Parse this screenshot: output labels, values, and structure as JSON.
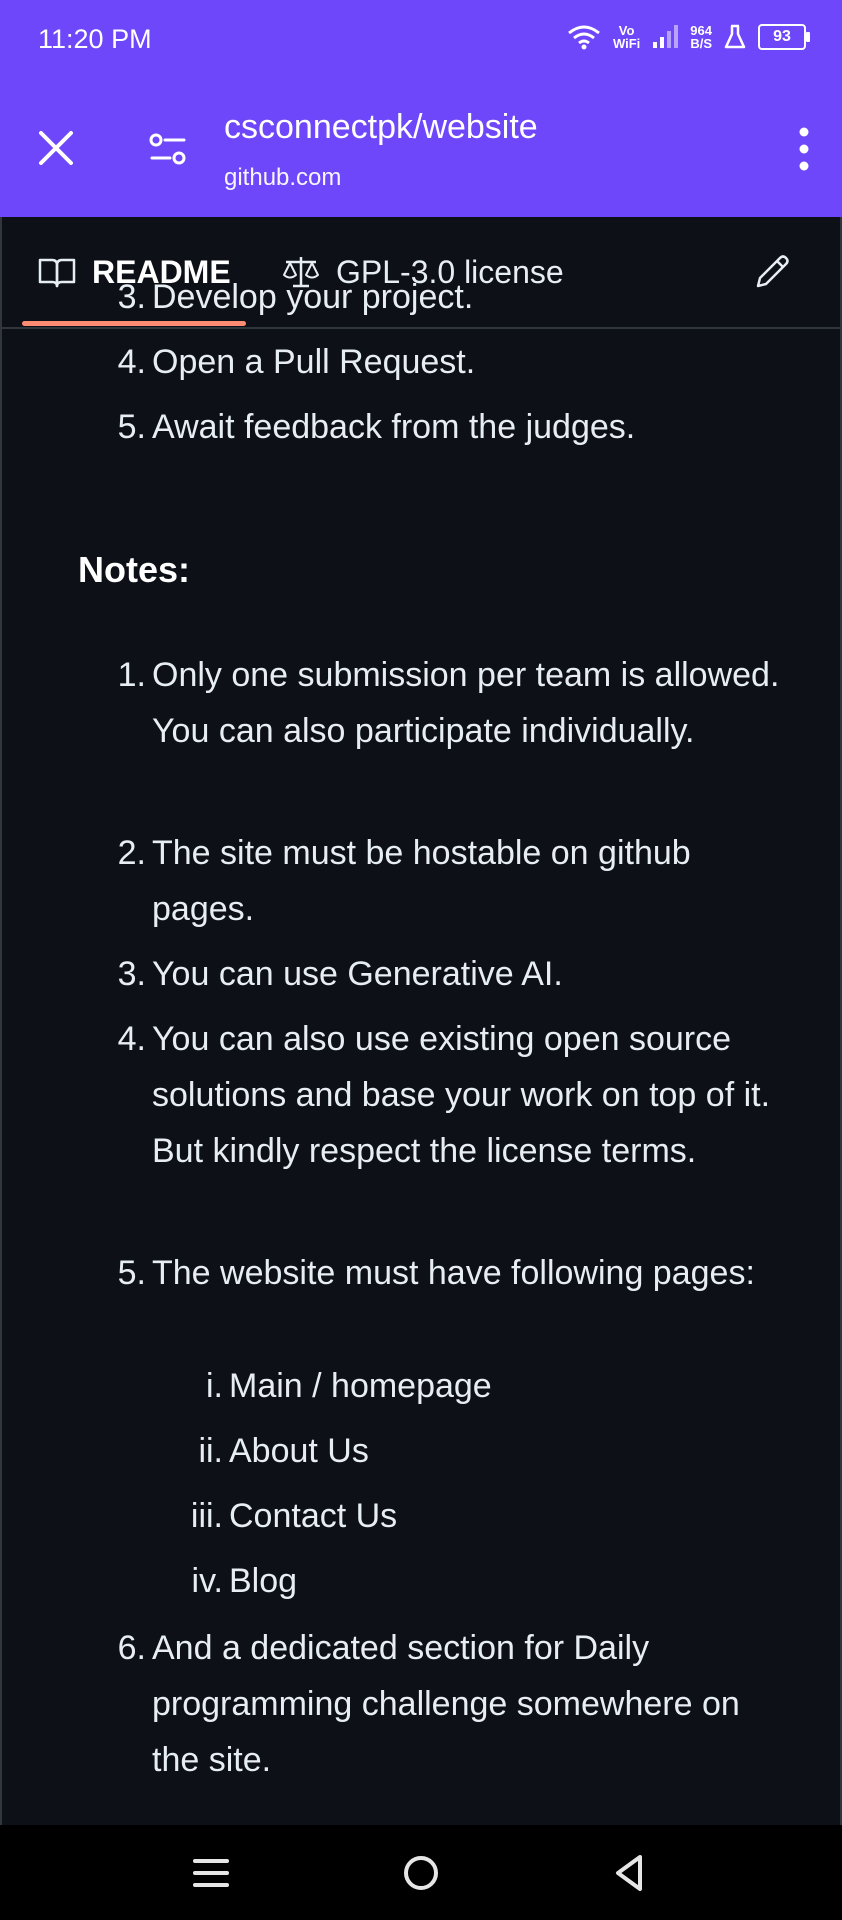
{
  "status": {
    "time": "11:20 PM",
    "vowifi_top": "Vo",
    "vowifi_bottom": "WiFi",
    "speed_top": "964",
    "speed_bottom": "B/S",
    "battery": "93"
  },
  "toolbar": {
    "title": "csconnectpk/website",
    "subtitle": "github.com"
  },
  "tabs": {
    "readme": "README",
    "license": "GPL-3.0 license"
  },
  "steps": [
    {
      "num": "3.",
      "text": "Develop your project."
    },
    {
      "num": "4.",
      "text": "Open a Pull Request."
    },
    {
      "num": "5.",
      "text": "Await feedback from the judges."
    }
  ],
  "notes_heading": "Notes:",
  "notes": [
    {
      "num": "1.",
      "text": "Only one submission per team is allowed. You can also participate individually."
    },
    {
      "num": "2.",
      "text": "The site must be hostable on github pages."
    },
    {
      "num": "3.",
      "text": "You can use Generative AI."
    },
    {
      "num": "4.",
      "text": "You can also use existing open source solutions and base your work on top of it. But kindly respect the license terms."
    },
    {
      "num": "5.",
      "text": "The website must have following pages:"
    },
    {
      "num": "6.",
      "text": "And a dedicated section for Daily programming challenge somewhere on the site."
    }
  ],
  "pages": [
    {
      "num": "i.",
      "text": "Main / homepage"
    },
    {
      "num": "ii.",
      "text": "About Us"
    },
    {
      "num": "iii.",
      "text": "Contact Us"
    },
    {
      "num": "iv.",
      "text": "Blog"
    }
  ],
  "icons": {
    "close": "close-icon",
    "tune": "tune-icon",
    "menu": "more-vert-icon",
    "book": "book-icon",
    "scale": "law-scale-icon",
    "edit": "pencil-icon"
  },
  "colors": {
    "accent": "#6e47fb",
    "background": "#0d1117",
    "tab_underline": "#fd8c73"
  }
}
